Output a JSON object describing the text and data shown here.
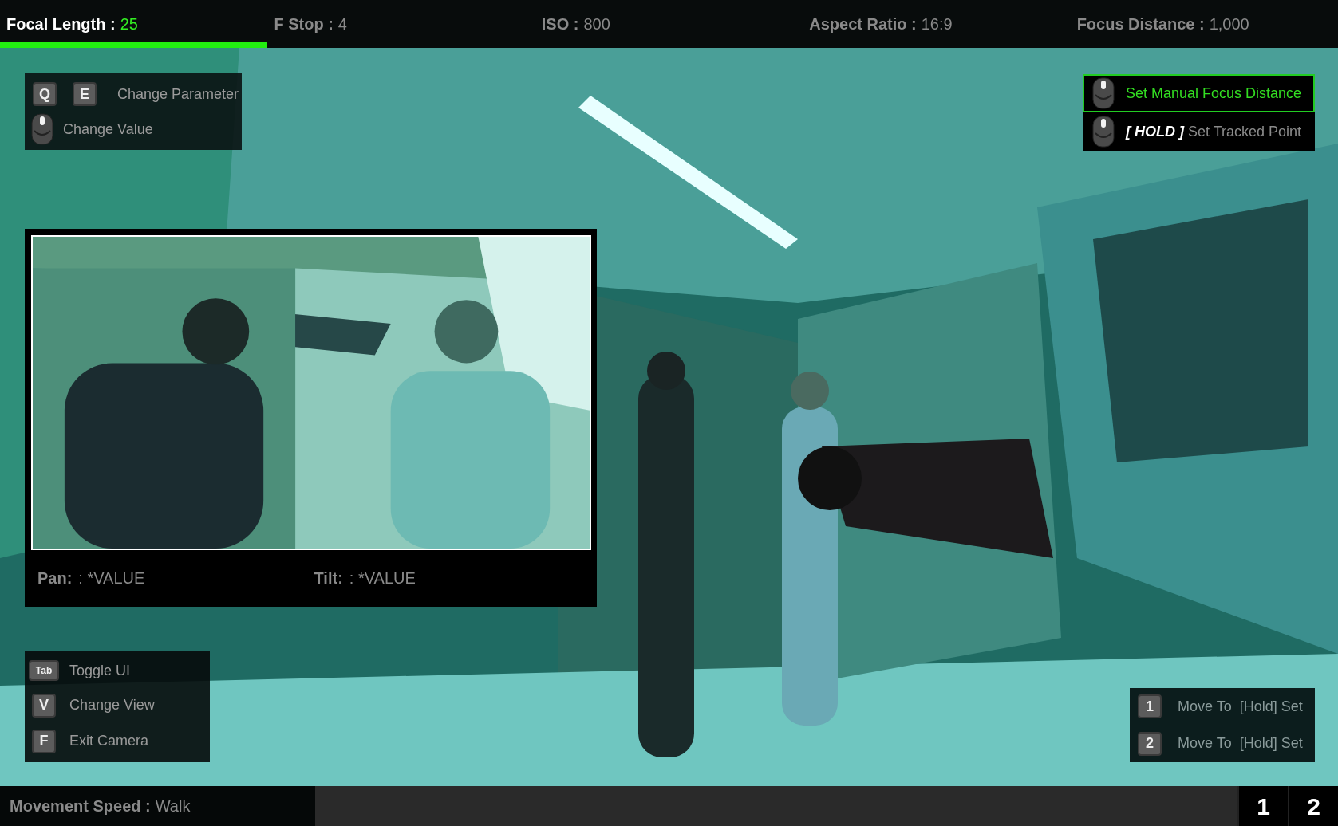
{
  "parameters": [
    {
      "label": "Focal Length :",
      "value": "25",
      "selected": true
    },
    {
      "label": "F Stop :",
      "value": "4",
      "selected": false
    },
    {
      "label": "ISO :",
      "value": "800",
      "selected": false
    },
    {
      "label": "Aspect Ratio :",
      "value": "16:9",
      "selected": false
    },
    {
      "label": "Focus Distance :",
      "value": "1,000",
      "selected": false
    }
  ],
  "controls": [
    {
      "kind": "keys",
      "keys": [
        "Q",
        "E"
      ],
      "action": "Change Parameter"
    },
    {
      "kind": "mouse",
      "action": "Change Value"
    }
  ],
  "focus_actions": [
    {
      "action": "Set Manual Focus Distance",
      "selected": true
    },
    {
      "hold": "[ HOLD ]",
      "action": "Set Tracked Point",
      "selected": false
    }
  ],
  "preview": {
    "kind": "picture",
    "readouts": [
      {
        "label": "Pan:",
        "value": ": *VALUE"
      },
      {
        "label": "Tilt:",
        "value": ": *VALUE"
      }
    ]
  },
  "shortcuts": [
    {
      "key": "Tab",
      "action": "Toggle UI"
    },
    {
      "key": "V",
      "action": "Change View"
    },
    {
      "key": "F",
      "action": "Exit Camera"
    }
  ],
  "waypoints": [
    {
      "key": "1",
      "action": "Move To  [Hold] Set"
    },
    {
      "key": "2",
      "action": "Move To  [Hold] Set"
    }
  ],
  "status_bar": {
    "label": "Movement Speed :",
    "value": "Walk",
    "slots": [
      "1",
      "2"
    ]
  }
}
